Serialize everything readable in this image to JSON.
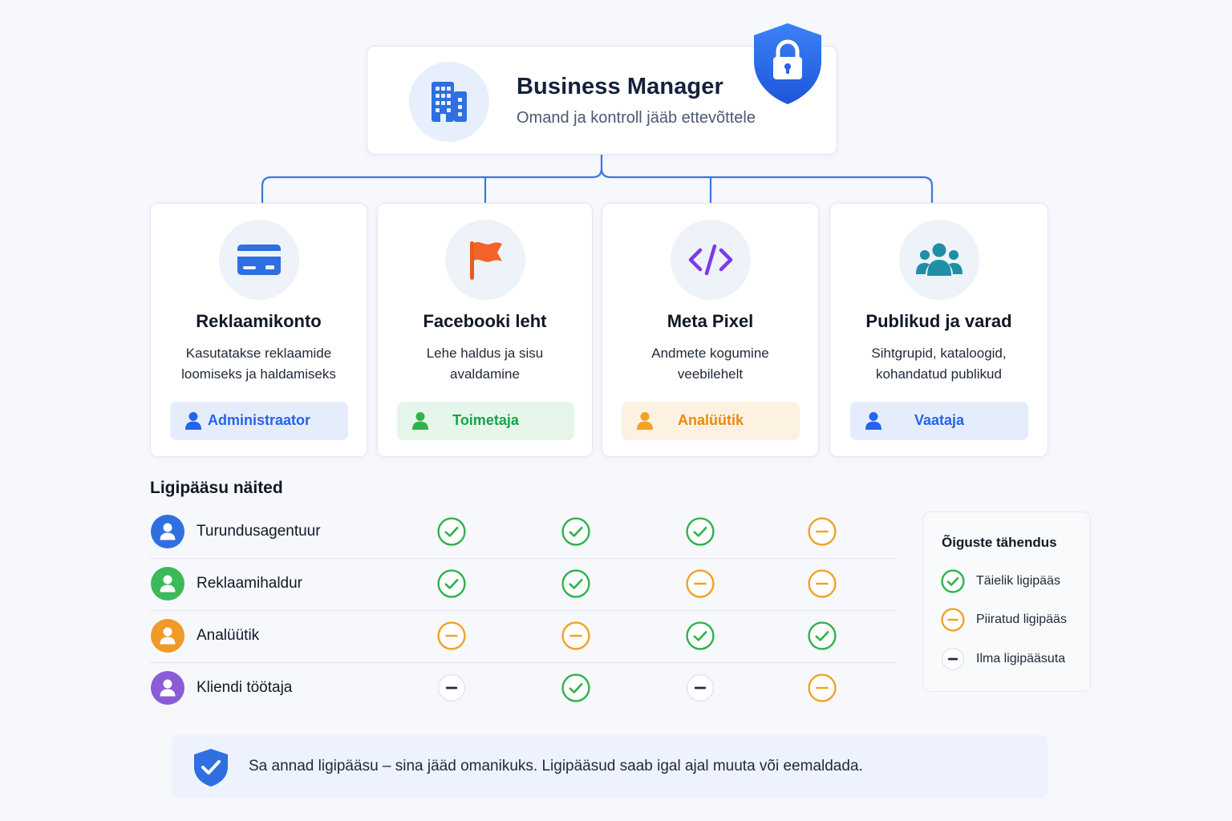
{
  "header": {
    "title": "Business Manager",
    "subtitle": "Omand ja kontroll jääb ettevõttele",
    "icon": "building-icon",
    "badge_icon": "shield-lock-icon"
  },
  "resources": [
    {
      "title": "Reklaamikonto",
      "desc_line1": "Kasutatakse reklaamide",
      "desc_line2": "loomiseks ja haldamiseks",
      "icon": "credit-card-icon",
      "role": "Administraator",
      "role_color": "#2563eb",
      "role_bg": "#e5edfc"
    },
    {
      "title": "Facebooki leht",
      "desc_line1": "Lehe haldus ja sisu",
      "desc_line2": "avaldamine",
      "icon": "flag-icon",
      "role": "Toimetaja",
      "role_color": "#16a34a",
      "role_bg": "#e7f6ea"
    },
    {
      "title": "Meta Pixel",
      "desc_line1": "Andmete kogumine",
      "desc_line2": "veebilehelt",
      "icon": "code-icon",
      "role": "Analüütik",
      "role_color": "#ea8a0c",
      "role_bg": "#fdf1e2"
    },
    {
      "title": "Publikud ja varad",
      "desc_line1": "Sihtgrupid, kataloogid,",
      "desc_line2": "kohandatud publikud",
      "icon": "people-group-icon",
      "role": "Vaataja",
      "role_color": "#2563eb",
      "role_bg": "#e5edfc"
    }
  ],
  "access": {
    "title": "Ligipääsu näited",
    "rows": [
      {
        "label": "Turundusagentuur",
        "avatar_color": "#2f6fe0",
        "access": [
          "full",
          "full",
          "full",
          "limited"
        ]
      },
      {
        "label": "Reklaamihaldur",
        "avatar_color": "#3cb95a",
        "access": [
          "full",
          "full",
          "limited",
          "limited"
        ]
      },
      {
        "label": "Analüütik",
        "avatar_color": "#f09a28",
        "access": [
          "limited",
          "limited",
          "full",
          "full"
        ]
      },
      {
        "label": "Kliendi töötaja",
        "avatar_color": "#8b5cd6",
        "access": [
          "none",
          "full",
          "none",
          "limited"
        ]
      }
    ]
  },
  "legend": {
    "title": "Õiguste tähendus",
    "items": [
      {
        "key": "full",
        "label": "Täielik ligipääs"
      },
      {
        "key": "limited",
        "label": "Piiratud ligipääs"
      },
      {
        "key": "none",
        "label": "Ilma ligipääsuta"
      }
    ]
  },
  "colors": {
    "full": "#2fb24c",
    "limited": "#f2a127",
    "none": "#1f2a44",
    "accent": "#2f6fe0"
  },
  "banner": {
    "text": "Sa annad ligipääsu – sina jääd omanikuks. Ligipääsud saab igal ajal muuta või eemaldada.",
    "icon": "shield-check-icon"
  }
}
